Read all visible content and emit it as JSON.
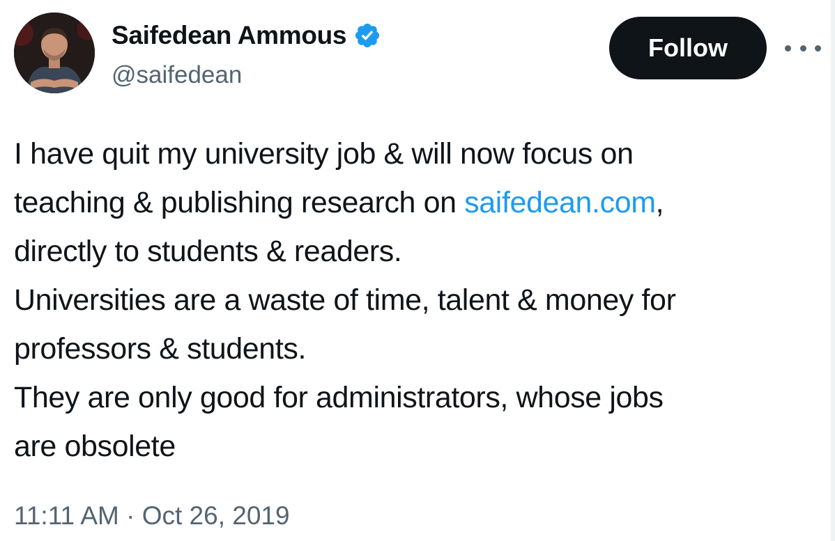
{
  "author": {
    "display_name": "Saifedean Ammous",
    "handle": "@saifedean",
    "verified": true,
    "avatar_icon": "profile-photo"
  },
  "actions": {
    "follow_label": "Follow",
    "more_icon": "ellipsis-icon"
  },
  "tweet": {
    "lines": [
      {
        "before": "I have quit my university job & will now focus on",
        "link": "",
        "after": ""
      },
      {
        "before": "teaching & publishing research on ",
        "link": "saifedean.com",
        "after": ","
      },
      {
        "before": "directly to students & readers.",
        "link": "",
        "after": ""
      },
      {
        "before": "Universities are a waste of time, talent & money for",
        "link": "",
        "after": ""
      },
      {
        "before": "professors & students.",
        "link": "",
        "after": ""
      },
      {
        "before": "They are only good for administrators, whose jobs",
        "link": "",
        "after": ""
      },
      {
        "before": "are obsolete",
        "link": "",
        "after": ""
      }
    ]
  },
  "timestamp": "11:11 AM · Oct 26, 2019",
  "colors": {
    "text": "#0f1419",
    "secondary": "#536471",
    "link": "#1d9bf0",
    "verified": "#1d9bf0",
    "button_bg": "#0f1419"
  }
}
